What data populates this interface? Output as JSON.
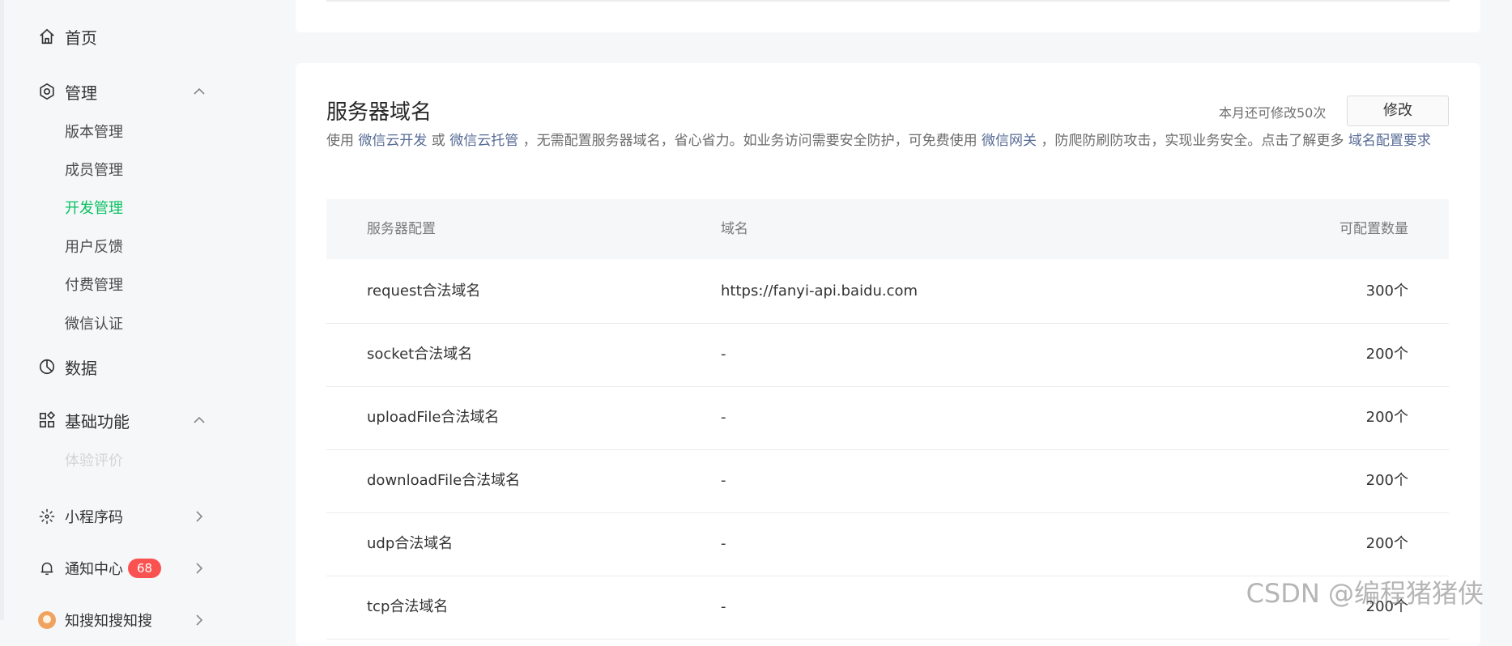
{
  "sidebar": {
    "home": "首页",
    "manage": {
      "label": "管理",
      "items": [
        "版本管理",
        "成员管理",
        "开发管理",
        "用户反馈",
        "付费管理",
        "微信认证"
      ]
    },
    "data": "数据",
    "basic": {
      "label": "基础功能",
      "items": [
        "体验评价"
      ]
    },
    "miniprogram_code": "小程序码",
    "notification": {
      "label": "通知中心",
      "badge": "68"
    },
    "partial_item": "知搜知搜知搜"
  },
  "card": {
    "title": "服务器域名",
    "quota": "本月还可修改50次",
    "edit_label": "修改",
    "desc": {
      "p1": "使用 ",
      "link1": "微信云开发",
      "p2": " 或 ",
      "link2": "微信云托管",
      "p3": " ，无需配置服务器域名，省心省力。如业务访问需要安全防护，可免费使用 ",
      "link3": "微信网关",
      "p4": " ，防爬防刷防攻击，实现业务安全。点击了解更多 ",
      "link4": "域名配置要求"
    },
    "table": {
      "headers": [
        "服务器配置",
        "域名",
        "可配置数量"
      ],
      "rows": [
        {
          "name": "request合法域名",
          "domain": "https://fanyi-api.baidu.com",
          "count": "300个"
        },
        {
          "name": "socket合法域名",
          "domain": "-",
          "count": "200个"
        },
        {
          "name": "uploadFile合法域名",
          "domain": "-",
          "count": "200个"
        },
        {
          "name": "downloadFile合法域名",
          "domain": "-",
          "count": "200个"
        },
        {
          "name": "udp合法域名",
          "domain": "-",
          "count": "200个"
        },
        {
          "name": "tcp合法域名",
          "domain": "-",
          "count": "200个"
        }
      ]
    }
  },
  "watermark": "CSDN @编程猪猪侠",
  "colors": {
    "accent": "#07c160",
    "link": "#576b95",
    "badge": "#fa5151"
  },
  "icons": [
    "home-icon",
    "settings-icon",
    "chevron-up-icon",
    "pie-chart-icon",
    "grid-icon",
    "qrcode-icon",
    "bell-icon",
    "chevron-right-icon",
    "avatar"
  ]
}
